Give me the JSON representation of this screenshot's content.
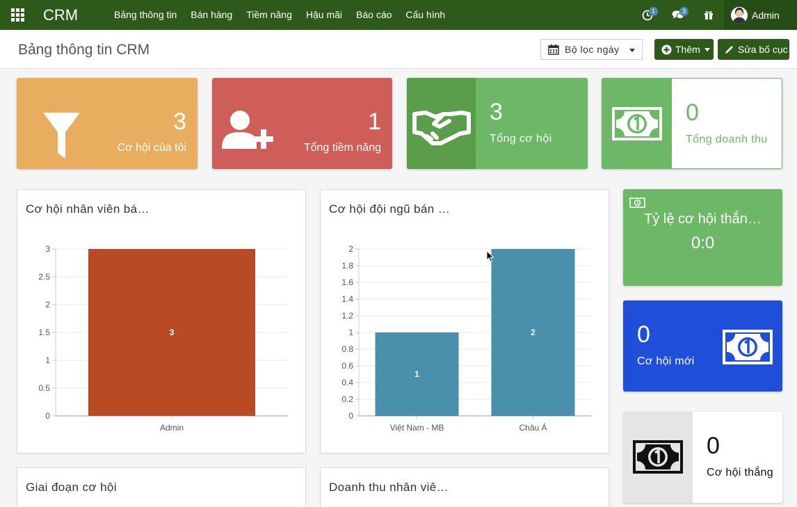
{
  "navbar": {
    "brand": "CRM",
    "menu": [
      "Bảng thông tin",
      "Bán hàng",
      "Tiềm năng",
      "Hậu mãi",
      "Báo cáo",
      "Cấu hình"
    ],
    "activity_badge": "1",
    "messages_badge": "3",
    "user": "Admin"
  },
  "control_panel": {
    "title": "Bảng thông tin CRM",
    "date_filter": "Bộ lọc ngày",
    "add_button": "Thêm",
    "edit_layout_button": "Sửa bố cục"
  },
  "tiles": [
    {
      "value": "3",
      "label": "Cơ hội của tôi",
      "icon": "filter-icon",
      "color": "#e8ad5f"
    },
    {
      "value": "1",
      "label": "Tổng tiềm năng",
      "icon": "user-plus-icon",
      "color": "#cf5d58"
    },
    {
      "value": "3",
      "label": "Tổng cơ hội",
      "icon": "handshake-icon",
      "color": "#6cb866"
    },
    {
      "value": "0",
      "label": "Tổng doanh thu",
      "icon": "money-icon",
      "color": "#6cb866"
    }
  ],
  "side_tiles": {
    "win_ratio": {
      "title": "Tỷ lệ cơ hội thắn…",
      "value": "0:0",
      "icon": "money-icon"
    },
    "new_opps": {
      "value": "0",
      "label": "Cơ hội mới",
      "icon": "money-icon"
    },
    "won_opps": {
      "value": "0",
      "label": "Cơ hội thắng",
      "icon": "money-icon"
    }
  },
  "panels": {
    "p3_title": "Giai đoạn cơ hội",
    "p4_title": "Doanh thu nhân viê…"
  },
  "chart_data": [
    {
      "type": "bar",
      "title": "Cơ hội nhân viên bá…",
      "categories": [
        "Admin"
      ],
      "values": [
        3
      ],
      "ylim": [
        0,
        3
      ],
      "yticks": [
        "0",
        "0.5",
        "1",
        "1.5",
        "2",
        "2.5",
        "3"
      ],
      "bar_color": "#b84a26",
      "grid": true
    },
    {
      "type": "bar",
      "title": "Cơ hội đội ngũ bán …",
      "categories": [
        "Việt Nam - MB",
        "Châu Á"
      ],
      "values": [
        1,
        2
      ],
      "ylim": [
        0,
        2
      ],
      "yticks": [
        "0",
        "0.2",
        "0.4",
        "0.6",
        "0.8",
        "1",
        "1.2",
        "1.4",
        "1.6",
        "1.8",
        "2"
      ],
      "bar_color": "#4a8fab",
      "grid": true
    }
  ]
}
